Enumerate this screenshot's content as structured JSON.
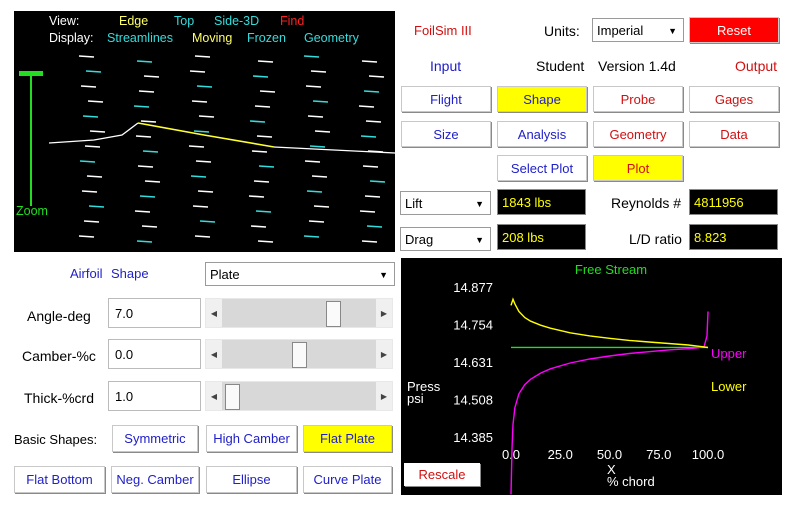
{
  "view": {
    "view_label": "View:",
    "view_options": [
      "Edge",
      "Top",
      "Side-3D",
      "Find"
    ],
    "display_label": "Display:",
    "display_options": [
      "Streamlines",
      "Moving",
      "Frozen",
      "Geometry"
    ],
    "zoom_label": "Zoom"
  },
  "header": {
    "app_title": "FoilSim III",
    "units_label": "Units:",
    "units_value": "Imperial",
    "reset_label": "Reset",
    "input_label": "Input",
    "student_label": "Student",
    "version_label": "Version 1.4d",
    "output_label": "Output"
  },
  "input_tabs": {
    "flight": "Flight",
    "shape": "Shape",
    "size": "Size",
    "analysis": "Analysis",
    "select_plot": "Select Plot"
  },
  "output_tabs": {
    "probe": "Probe",
    "gages": "Gages",
    "geometry": "Geometry",
    "data": "Data",
    "plot": "Plot"
  },
  "results": {
    "lift_select": "Lift",
    "lift_value": "1843 lbs",
    "drag_select": "Drag",
    "drag_value": "208 lbs",
    "reynolds_label": "Reynolds #",
    "reynolds_value": "4811956",
    "ld_label": "L/D ratio",
    "ld_value": "8.823"
  },
  "shape_panel": {
    "airfoil_label": "Airfoil",
    "shape_label": "Shape",
    "shape_value": "Plate",
    "angle_label": "Angle-deg",
    "angle_value": "7.0",
    "angle_slider": 0.75,
    "camber_label": "Camber-%c",
    "camber_value": "0.0",
    "camber_slider": 0.5,
    "thick_label": "Thick-%crd",
    "thick_value": "1.0",
    "thick_slider": 0.02,
    "basic_shapes_label": "Basic Shapes:",
    "buttons": {
      "symmetric": "Symmetric",
      "high_camber": "High Camber",
      "flat_plate": "Flat Plate",
      "flat_bottom": "Flat Bottom",
      "neg_camber": "Neg. Camber",
      "ellipse": "Ellipse",
      "curve_plate": "Curve Plate"
    }
  },
  "chart_data": {
    "type": "line",
    "title": "Free Stream",
    "ylabel": "Press psi",
    "xlabel": "X % chord",
    "x_ticks": [
      "0.0",
      "25.0",
      "50.0",
      "75.0",
      "100.0"
    ],
    "y_ticks": [
      "14.877",
      "14.754",
      "14.631",
      "14.508",
      "14.385"
    ],
    "xlim": [
      0,
      100
    ],
    "ylim": [
      14.385,
      14.877
    ],
    "free_stream": 14.682,
    "series": [
      {
        "name": "Upper",
        "color": "#ff00ff",
        "x": [
          0,
          0.5,
          1,
          2,
          4,
          7,
          10,
          15,
          20,
          30,
          40,
          50,
          60,
          70,
          80,
          90,
          95,
          98,
          99.5,
          100
        ],
        "y": [
          14.2,
          14.35,
          14.43,
          14.485,
          14.53,
          14.56,
          14.578,
          14.598,
          14.612,
          14.631,
          14.644,
          14.654,
          14.662,
          14.668,
          14.674,
          14.678,
          14.681,
          14.685,
          14.72,
          14.8
        ]
      },
      {
        "name": "Lower",
        "color": "#ffff00",
        "x": [
          0,
          1,
          2,
          4,
          7,
          10,
          15,
          20,
          30,
          40,
          50,
          60,
          70,
          80,
          90,
          95,
          100
        ],
        "y": [
          14.82,
          14.84,
          14.825,
          14.8,
          14.78,
          14.768,
          14.755,
          14.745,
          14.73,
          14.72,
          14.712,
          14.705,
          14.7,
          14.695,
          14.69,
          14.686,
          14.682
        ]
      }
    ]
  },
  "plot_panel": {
    "rescale_label": "Rescale"
  },
  "colors": {
    "upper": "#ff00ff",
    "lower": "#ffff00",
    "free_stream": "#22dd22",
    "reset": "#ff0000",
    "highlight": "#ffff00"
  }
}
